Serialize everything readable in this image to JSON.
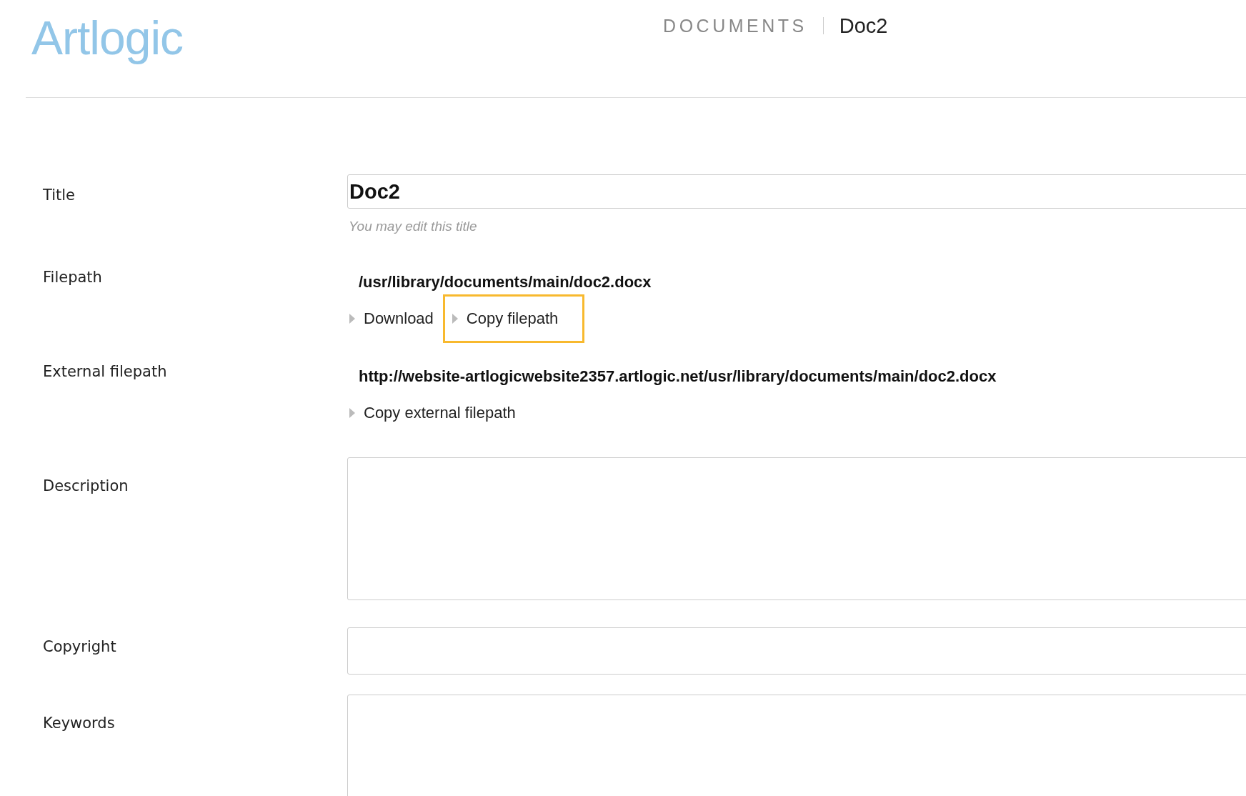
{
  "header": {
    "logo": "Artlogic",
    "breadcrumb": [
      {
        "label": "DOCUMENTS",
        "kind": "section"
      },
      {
        "label": "Doc2",
        "kind": "current"
      }
    ]
  },
  "form": [
    {
      "kind": "input",
      "label": "Title",
      "value": "Doc2",
      "hint": "You may edit this title"
    },
    {
      "kind": "path",
      "label": "Filepath",
      "path": "/usr/library/documents/main/doc2.docx",
      "links": [
        {
          "label": "Download",
          "highlighted": false
        },
        {
          "label": "Copy filepath",
          "highlighted": true
        }
      ]
    },
    {
      "kind": "path",
      "label": "External filepath",
      "path": "http://website-artlogicwebsite2357.artlogic.net/usr/library/documents/main/doc2.docx",
      "links": [
        {
          "label": "Copy external filepath",
          "highlighted": false
        }
      ]
    },
    {
      "kind": "textarea",
      "label": "Description"
    },
    {
      "kind": "field",
      "label": "Copyright"
    },
    {
      "kind": "textarea",
      "label": "Keywords"
    }
  ]
}
